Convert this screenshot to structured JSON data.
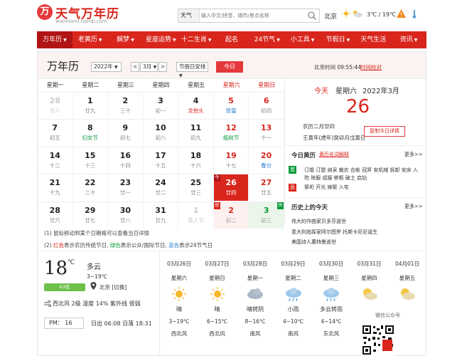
{
  "header": {
    "logo_mark": "万",
    "logo_text": "天气万年历",
    "logo_sub": "wannianli.tianqi.com",
    "search_type": "天气",
    "search_placeholder": "输入中文/拼音、城市/景点名称",
    "city": "北京",
    "temp": "3℃ / 19℃"
  },
  "nav": [
    {
      "label": "万年历",
      "caret": "▼",
      "active": true
    },
    {
      "label": "老黄历",
      "caret": "▼"
    },
    {
      "label": "解梦",
      "caret": "▼"
    },
    {
      "label": "星座运势",
      "caret": "▼"
    },
    {
      "label": "十二生肖",
      "caret": "▼"
    },
    {
      "label": "起名",
      "caret": ""
    },
    {
      "label": "24节气",
      "caret": "▼"
    },
    {
      "label": "小工具",
      "caret": "▼"
    },
    {
      "label": "节假日",
      "caret": "▼"
    },
    {
      "label": "天气生活",
      "caret": ""
    },
    {
      "label": "资讯",
      "caret": "▼"
    }
  ],
  "calendar": {
    "title": "万年历",
    "year_select": "2022年",
    "prev": "<",
    "month_select": "3月",
    "next": ">",
    "holiday_select": "节假日安排",
    "today_button": "今日",
    "beijing_time": "北京时间 09:55:44",
    "calibrate": "时间校对",
    "weekdays": [
      "星期一",
      "星期二",
      "星期三",
      "星期四",
      "星期五",
      "星期六",
      "星期日"
    ],
    "weeks": [
      [
        {
          "d": "28",
          "l": "廿八",
          "dim": true
        },
        {
          "d": "1",
          "l": "廿九"
        },
        {
          "d": "2",
          "l": "三十"
        },
        {
          "d": "3",
          "l": "初一"
        },
        {
          "d": "4",
          "l": "龙抬头",
          "lc": "red"
        },
        {
          "d": "5",
          "l": "惊蛰",
          "lc": "blue",
          "we": true
        },
        {
          "d": "6",
          "l": "初四",
          "we": true
        }
      ],
      [
        {
          "d": "7",
          "l": "初五"
        },
        {
          "d": "8",
          "l": "妇女节",
          "lc": "green"
        },
        {
          "d": "9",
          "l": "初七"
        },
        {
          "d": "10",
          "l": "初八"
        },
        {
          "d": "11",
          "l": "初九"
        },
        {
          "d": "12",
          "l": "植树节",
          "lc": "green",
          "we": true
        },
        {
          "d": "13",
          "l": "十一",
          "we": true
        }
      ],
      [
        {
          "d": "14",
          "l": "十二"
        },
        {
          "d": "15",
          "l": "十三"
        },
        {
          "d": "16",
          "l": "十四"
        },
        {
          "d": "17",
          "l": "十五"
        },
        {
          "d": "18",
          "l": "十六"
        },
        {
          "d": "19",
          "l": "十七",
          "we": true
        },
        {
          "d": "20",
          "l": "春分",
          "lc": "blue",
          "we": true
        }
      ],
      [
        {
          "d": "21",
          "l": "十九"
        },
        {
          "d": "22",
          "l": "二十"
        },
        {
          "d": "23",
          "l": "廿一"
        },
        {
          "d": "24",
          "l": "廿二"
        },
        {
          "d": "25",
          "l": "廿三"
        },
        {
          "d": "26",
          "l": "廿四",
          "today": true,
          "tag": "今"
        },
        {
          "d": "27",
          "l": "廿五",
          "we": true
        }
      ],
      [
        {
          "d": "28",
          "l": "廿六"
        },
        {
          "d": "29",
          "l": "廿七"
        },
        {
          "d": "30",
          "l": "廿八"
        },
        {
          "d": "31",
          "l": "廿九"
        },
        {
          "d": "1",
          "l": "愚人节",
          "dim": true
        },
        {
          "d": "2",
          "l": "初二",
          "dim": true,
          "tag": "班",
          "wkbg": true
        },
        {
          "d": "3",
          "l": "初三",
          "dim": true,
          "tag": "休",
          "holi": true
        }
      ]
    ],
    "note1": "(1) 鼠标移动到某个日期格可以查看当日详情",
    "note2_a": "(2) ",
    "note2_red": "红色",
    "note2_b": "表示农历传统节日, ",
    "note2_green": "绿色",
    "note2_c": "表示公众/国际节日, ",
    "note2_blue": "蓝色",
    "note2_d": "表示24节气日"
  },
  "today_panel": {
    "today": "今天",
    "weekday": "星期六",
    "year_month": "2022年3月",
    "day": "26",
    "lunar": "农历二月廿四",
    "ganzhi": "壬寅年(虎年)癸卯月戊寅日",
    "copy_button": "复制今日详情",
    "huangli_title": "今日黄历",
    "huangli_link": "黄历名词解释",
    "more": "更多>>",
    "yi_label": "宜",
    "yi_text": "订婚 订盟 纳采 裁衣 合帐 冠笄 安机械 拆卸 安床 入殓 除服 成服 移柩 破土 启钻",
    "ji_label": "忌",
    "ji_text": "祭祀 开光 嫁娶 入宅",
    "history_title": "历史上的今天",
    "history": [
      "伟大的作曲家贝多芬逝世",
      "意大利指挥家阿尔图罗·托斯卡尼尼诞生",
      "美国诗人惠特曼逝世"
    ]
  },
  "weather": {
    "temp": "18",
    "unit": "℃",
    "desc": "多云",
    "range": "3~19℃",
    "aqi": "63优",
    "city": "北京 [切换]",
    "line": "西北风 2级   湿度 14%  紫外线 很弱",
    "pm": "PM：  16",
    "sun": "日出 06:08   日落 18:31",
    "forecast": [
      {
        "date": "03月26日",
        "wd": "星期六",
        "icon": "sun",
        "desc": "晴",
        "temp": "3~19℃",
        "wind": "西北风"
      },
      {
        "date": "03月27日",
        "wd": "星期日",
        "icon": "sun",
        "desc": "晴",
        "temp": "6~15℃",
        "wind": "西北风"
      },
      {
        "date": "03月28日",
        "wd": "星期一",
        "icon": "cloud",
        "desc": "晴转阴",
        "temp": "8~16℃",
        "wind": "南风"
      },
      {
        "date": "03月29日",
        "wd": "星期二",
        "icon": "rain",
        "desc": "小雨",
        "temp": "4~10℃",
        "wind": "南风"
      },
      {
        "date": "03月30日",
        "wd": "星期三",
        "icon": "rain",
        "desc": "多云转雨",
        "temp": "4~14℃",
        "wind": "东北风"
      },
      {
        "date": "03月31日",
        "wd": "星期四",
        "icon": "partly",
        "desc": "",
        "temp": "",
        "wind": ""
      },
      {
        "date": "04月01日",
        "wd": "星期五",
        "icon": "partly",
        "desc": "",
        "temp": "",
        "wind": ""
      }
    ],
    "wechat_label": "微信公众号"
  }
}
